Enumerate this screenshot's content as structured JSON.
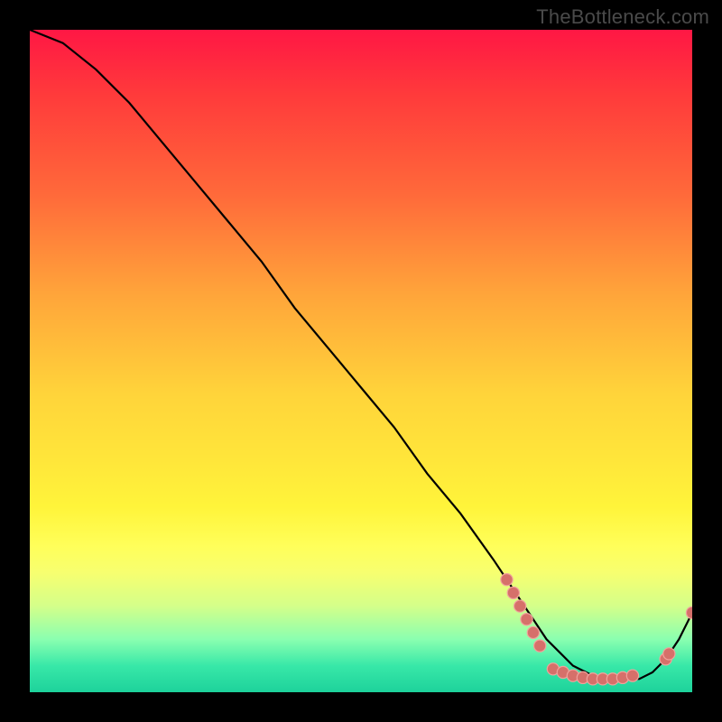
{
  "watermark": "TheBottleneck.com",
  "chart_data": {
    "type": "line",
    "title": "",
    "xlabel": "",
    "ylabel": "",
    "xlim": [
      0,
      100
    ],
    "ylim": [
      0,
      100
    ],
    "series": [
      {
        "name": "bottleneck-curve",
        "x": [
          0,
          5,
          10,
          15,
          20,
          25,
          30,
          35,
          40,
          45,
          50,
          55,
          60,
          65,
          70,
          72,
          74,
          76,
          78,
          80,
          82,
          84,
          86,
          88,
          90,
          92,
          94,
          96,
          98,
          100
        ],
        "y": [
          100,
          98,
          94,
          89,
          83,
          77,
          71,
          65,
          58,
          52,
          46,
          40,
          33,
          27,
          20,
          17,
          14,
          11,
          8,
          6,
          4,
          3,
          2,
          2,
          2,
          2,
          3,
          5,
          8,
          12
        ]
      }
    ],
    "marker_clusters": [
      {
        "name": "descent-cluster",
        "points_xy": [
          [
            72,
            17
          ],
          [
            73,
            15
          ],
          [
            74,
            13
          ],
          [
            75,
            11
          ],
          [
            76,
            9
          ],
          [
            77,
            7
          ]
        ]
      },
      {
        "name": "valley-cluster",
        "points_xy": [
          [
            79,
            3.5
          ],
          [
            80.5,
            3
          ],
          [
            82,
            2.5
          ],
          [
            83.5,
            2.2
          ],
          [
            85,
            2
          ],
          [
            86.5,
            2
          ],
          [
            88,
            2
          ],
          [
            89.5,
            2.2
          ],
          [
            91,
            2.5
          ]
        ]
      },
      {
        "name": "tail-cluster",
        "points_xy": [
          [
            96,
            5
          ],
          [
            96.5,
            5.8
          ],
          [
            100,
            12
          ]
        ]
      }
    ],
    "colors": {
      "curve": "#000000",
      "dot_fill": "#d6706a",
      "dot_stroke": "#f0a29c",
      "gradient_top": "#ff1744",
      "gradient_bottom": "#1dd29b",
      "frame": "#000000",
      "watermark": "#4a4a4a"
    }
  }
}
